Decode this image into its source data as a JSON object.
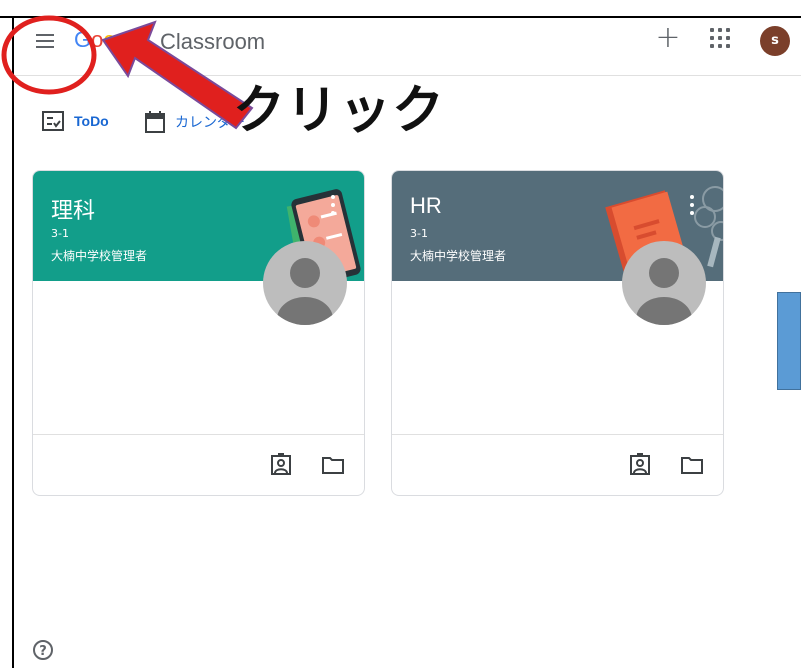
{
  "app": {
    "logo_letters": [
      "G",
      "o",
      "o"
    ],
    "product_name": "Classroom",
    "add_icon": "plus-icon",
    "apps_icon": "apps-grid-icon",
    "avatar_initial": "s"
  },
  "nav": {
    "todo_label": "ToDo",
    "calendar_label": "カレンダー"
  },
  "cards": [
    {
      "title": "理科",
      "section": "3-1",
      "teacher": "大楠中学校管理者",
      "banner_color": "#129e8a"
    },
    {
      "title": "HR",
      "section": "3-1",
      "teacher": "大楠中学校管理者",
      "banner_color": "#556d7a"
    }
  ],
  "annotation": {
    "text": "クリック",
    "circle_color": "#e0201e",
    "arrow_color": "#e0201e"
  },
  "footer": {
    "help_icon": "help-icon",
    "help_symbol": "?"
  }
}
